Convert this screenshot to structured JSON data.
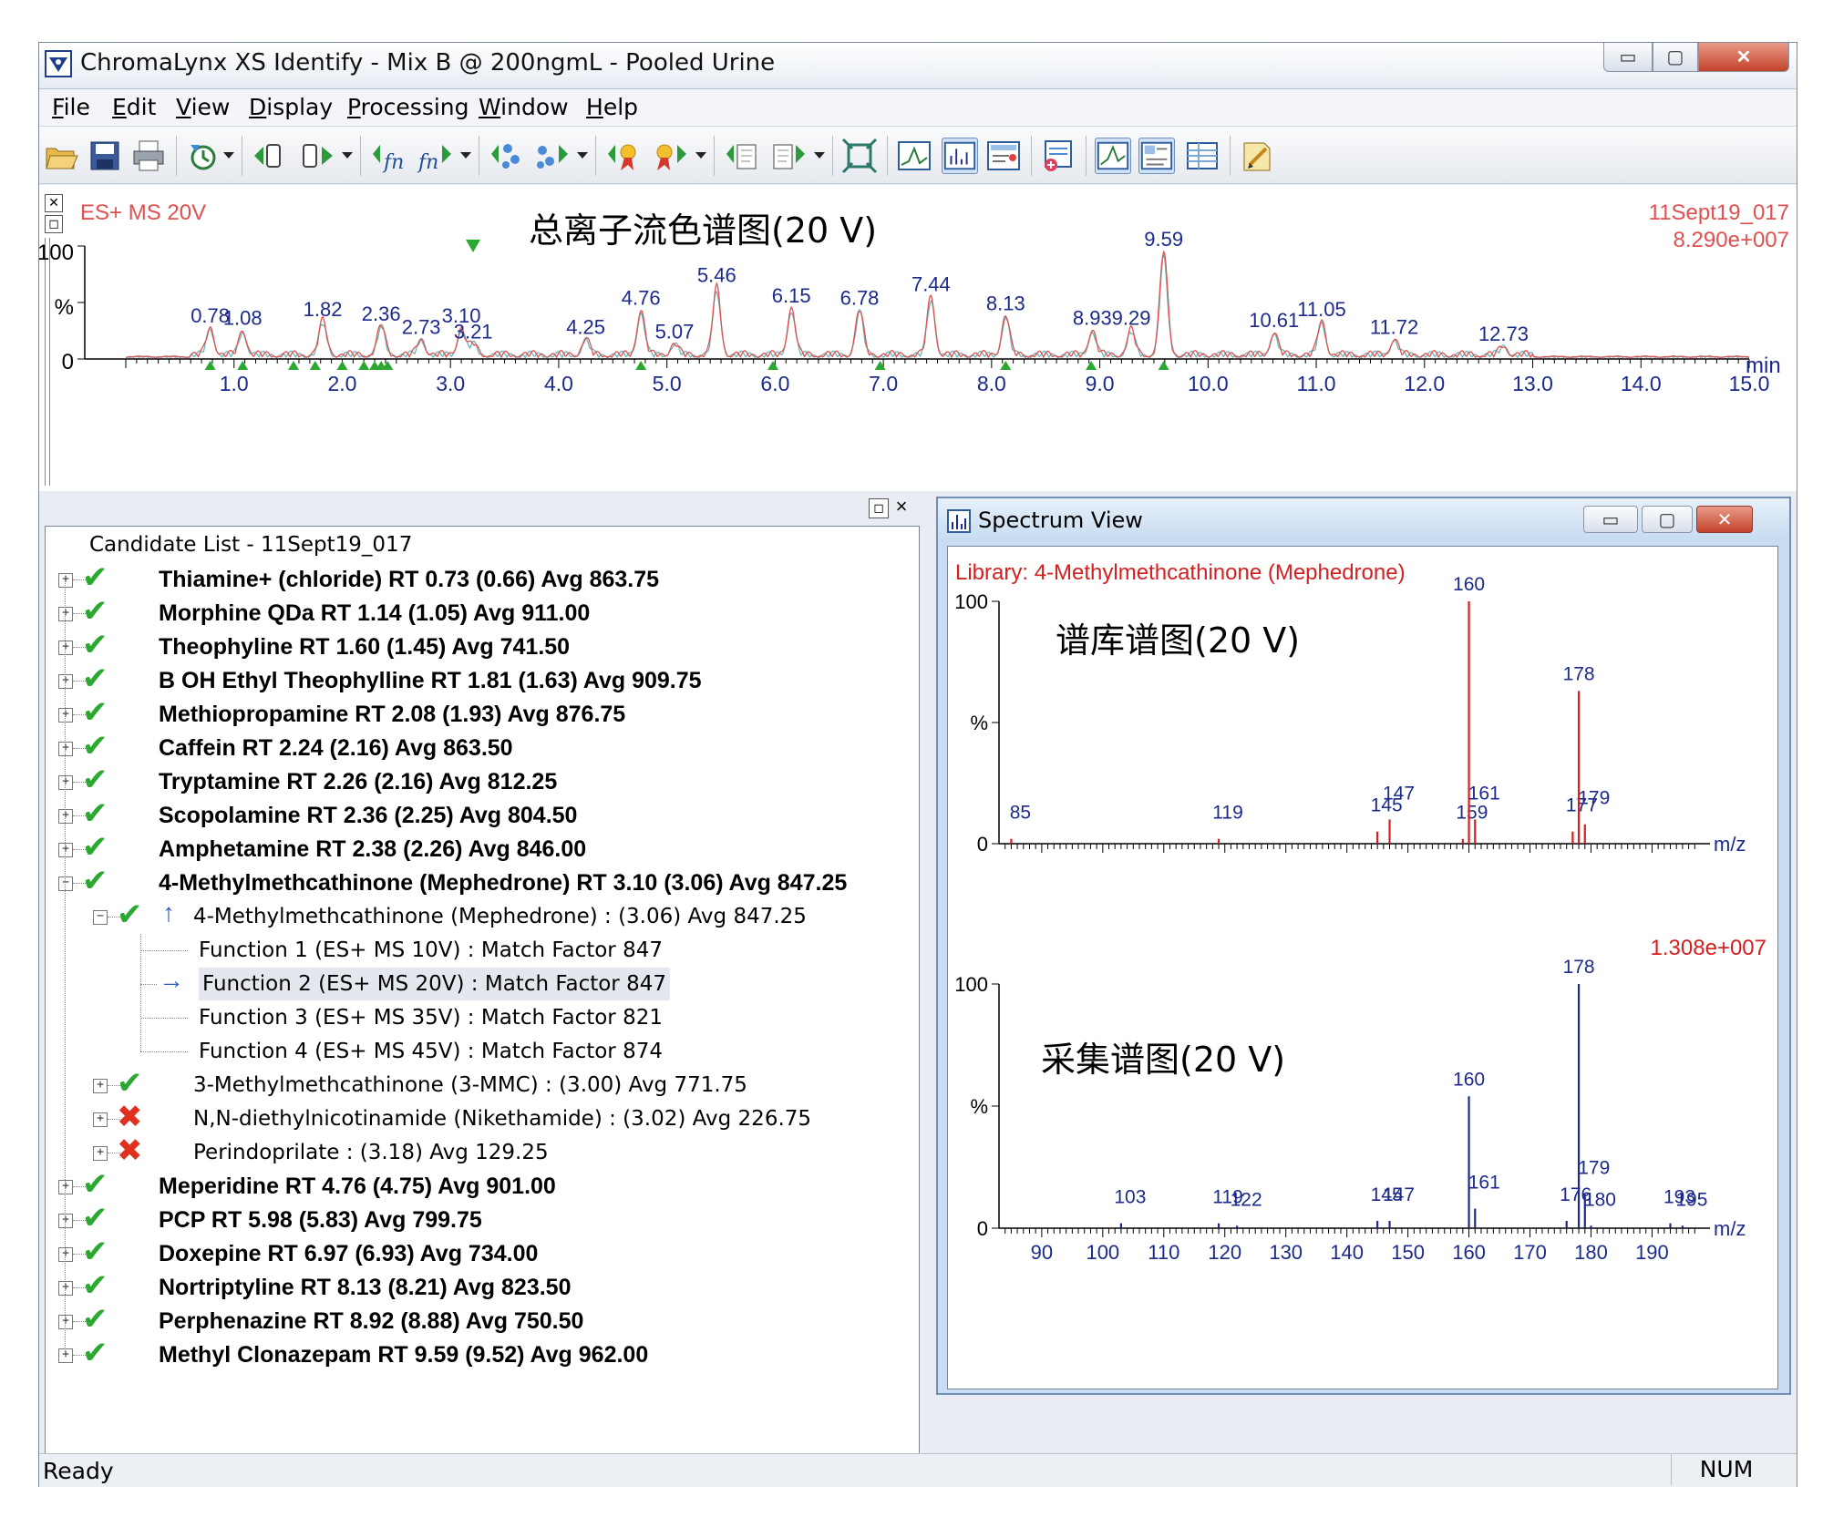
{
  "window": {
    "title": "ChromaLynx XS Identify - Mix B @ 200ngmL - Pooled Urine"
  },
  "menu": [
    "File",
    "Edit",
    "View",
    "Display",
    "Processing",
    "Window",
    "Help"
  ],
  "toolbar_icons": [
    "open-icon",
    "save-icon",
    "print-icon",
    "process-icon",
    "function-prev-icon",
    "function-next-icon",
    "fn-prev-icon",
    "fn-next-icon",
    "peak-prev-icon",
    "peak-next-icon",
    "candidate-prev-icon",
    "candidate-next-icon",
    "library-prev-icon",
    "library-next-icon",
    "fit-icon",
    "chromatogram-view-icon",
    "spectrum-view-icon",
    "library-view-icon",
    "add-library-icon",
    "tic-toggle-icon",
    "spectrum-toggle-icon",
    "table-toggle-icon",
    "report-icon"
  ],
  "tic": {
    "trace_label": "ES+ MS  20V",
    "annotation": "总离子流色谱图(20 V)",
    "file_id": "11Sept19_017",
    "intensity": "8.290e+007",
    "y_labels": {
      "top": "100",
      "mid": "%",
      "bottom": "0"
    },
    "x_unit": "min",
    "x_ticks": [
      "1.0",
      "2.0",
      "3.0",
      "4.0",
      "5.0",
      "6.0",
      "7.0",
      "8.0",
      "9.0",
      "10.0",
      "11.0",
      "12.0",
      "13.0",
      "14.0",
      "15.0"
    ]
  },
  "candidate_list": {
    "title": "Candidate List - 11Sept19_017",
    "pane_buttons": {
      "restore": "◻",
      "close": "×"
    },
    "top_items": [
      {
        "label": "Thiamine+ (chloride) RT 0.73 (0.66) Avg 863.75",
        "status": "pass"
      },
      {
        "label": "Morphine QDa RT 1.14 (1.05) Avg 911.00",
        "status": "pass"
      },
      {
        "label": "Theophyline RT 1.60 (1.45) Avg 741.50",
        "status": "pass"
      },
      {
        "label": "B OH Ethyl Theophylline RT 1.81 (1.63) Avg 909.75",
        "status": "pass"
      },
      {
        "label": "Methiopropamine RT 2.08 (1.93) Avg 876.75",
        "status": "pass"
      },
      {
        "label": "Caffein RT 2.24 (2.16) Avg 863.50",
        "status": "pass"
      },
      {
        "label": "Tryptamine RT 2.26 (2.16) Avg 812.25",
        "status": "pass"
      },
      {
        "label": "Scopolamine RT 2.36 (2.25) Avg 804.50",
        "status": "pass"
      },
      {
        "label": "Amphetamine RT 2.38 (2.26) Avg 846.00",
        "status": "pass"
      },
      {
        "label": "4-Methylmethcathinone (Mephedrone) RT 3.10 (3.06) Avg 847.25",
        "status": "pass"
      }
    ],
    "sub_item": {
      "label": "4-Methylmethcathinone (Mephedrone) : (3.06) Avg 847.25",
      "status": "pass"
    },
    "functions": [
      "Function 1 (ES+ MS  10V) : Match Factor 847",
      "Function 2 (ES+ MS  20V) : Match Factor 847",
      "Function 3 (ES+ MS  35V) : Match Factor 821",
      "Function 4 (ES+ MS  45V) : Match Factor 874"
    ],
    "alternatives": [
      {
        "label": "3-Methylmethcathinone (3-MMC) : (3.00) Avg 771.75",
        "status": "pass"
      },
      {
        "label": "N,N-diethylnicotinamide (Nikethamide) : (3.02) Avg 226.75",
        "status": "fail"
      },
      {
        "label": "Perindoprilate : (3.18) Avg 129.25",
        "status": "fail"
      }
    ],
    "bottom_items": [
      {
        "label": "Meperidine RT 4.76 (4.75) Avg 901.00",
        "status": "pass"
      },
      {
        "label": "PCP RT 5.98 (5.83) Avg 799.75",
        "status": "pass"
      },
      {
        "label": "Doxepine RT 6.97 (6.93) Avg 734.00",
        "status": "pass"
      },
      {
        "label": "Nortriptyline RT 8.13 (8.21) Avg 823.50",
        "status": "pass"
      },
      {
        "label": "Perphenazine RT 8.92 (8.88) Avg 750.50",
        "status": "pass"
      },
      {
        "label": "Methyl Clonazepam RT 9.59 (9.52) Avg 962.00",
        "status": "pass"
      }
    ],
    "glyphs": {
      "pass": "✔",
      "fail": "✖",
      "expand": "+",
      "collapse": "−",
      "up_arrow": "↑",
      "right_arrow": "→"
    }
  },
  "spectrum_view": {
    "title": "Spectrum View",
    "library_label": "Library: 4-Methylmethcathinone (Mephedrone)",
    "library_annotation": "谱库谱图(20 V)",
    "acquired_annotation": "采集谱图(20 V)",
    "acquired_intensity": "1.308e+007",
    "y_labels": {
      "top": "100",
      "mid": "%",
      "bottom": "0"
    },
    "x_unit": "m/z",
    "x_ticks": [
      "90",
      "100",
      "110",
      "120",
      "130",
      "140",
      "150",
      "160",
      "170",
      "180",
      "190"
    ]
  },
  "status": {
    "text": "Ready",
    "num": "NUM"
  },
  "colors": {
    "library": "#d42020",
    "acquired": "#1c2a8c",
    "tic_red": "#e05050",
    "tic_teal": "#66b8b8",
    "peak_label": "#1c2a8c",
    "ok": "#2aa830",
    "fail": "#e0301e"
  },
  "chart_data": [
    {
      "type": "line",
      "title": "",
      "xlabel": "min",
      "ylabel": "%",
      "xlim": [
        0.0,
        15.0
      ],
      "ylim": [
        0,
        100
      ],
      "peaks": [
        {
          "x": 0.78,
          "y": 24
        },
        {
          "x": 1.08,
          "y": 22
        },
        {
          "x": 1.82,
          "y": 30
        },
        {
          "x": 2.36,
          "y": 26
        },
        {
          "x": 2.73,
          "y": 14
        },
        {
          "x": 3.1,
          "y": 24
        },
        {
          "x": 3.21,
          "y": 10
        },
        {
          "x": 4.25,
          "y": 14
        },
        {
          "x": 4.76,
          "y": 40
        },
        {
          "x": 5.07,
          "y": 10
        },
        {
          "x": 5.46,
          "y": 60
        },
        {
          "x": 6.15,
          "y": 42
        },
        {
          "x": 6.78,
          "y": 40
        },
        {
          "x": 7.44,
          "y": 52
        },
        {
          "x": 8.13,
          "y": 35
        },
        {
          "x": 8.93,
          "y": 22
        },
        {
          "x": 9.29,
          "y": 22
        },
        {
          "x": 9.59,
          "y": 92
        },
        {
          "x": 10.61,
          "y": 20
        },
        {
          "x": 11.05,
          "y": 30
        },
        {
          "x": 11.72,
          "y": 14
        },
        {
          "x": 12.73,
          "y": 8
        }
      ],
      "markers": [
        0.78,
        1.08,
        1.55,
        1.75,
        2.0,
        2.2,
        2.3,
        2.36,
        2.42,
        4.76,
        5.98,
        6.97,
        8.13,
        8.92,
        9.59
      ]
    },
    {
      "type": "bar",
      "title": "Library: 4-Methylmethcathinone (Mephedrone)",
      "xlabel": "m/z",
      "ylabel": "%",
      "ylim": [
        0,
        100
      ],
      "x": [
        85,
        119,
        145,
        147,
        159,
        160,
        161,
        177,
        178,
        179
      ],
      "values": [
        2,
        2,
        5,
        10,
        2,
        100,
        10,
        5,
        63,
        8
      ]
    },
    {
      "type": "bar",
      "title": "",
      "xlabel": "m/z",
      "ylabel": "%",
      "ylim": [
        0,
        100
      ],
      "xlim": [
        83,
        198
      ],
      "x": [
        103,
        119,
        122,
        145,
        147,
        160,
        161,
        176,
        178,
        179,
        180,
        193,
        195
      ],
      "values": [
        2,
        2,
        1,
        3,
        3,
        54,
        8,
        3,
        100,
        14,
        1,
        2,
        1
      ]
    }
  ]
}
